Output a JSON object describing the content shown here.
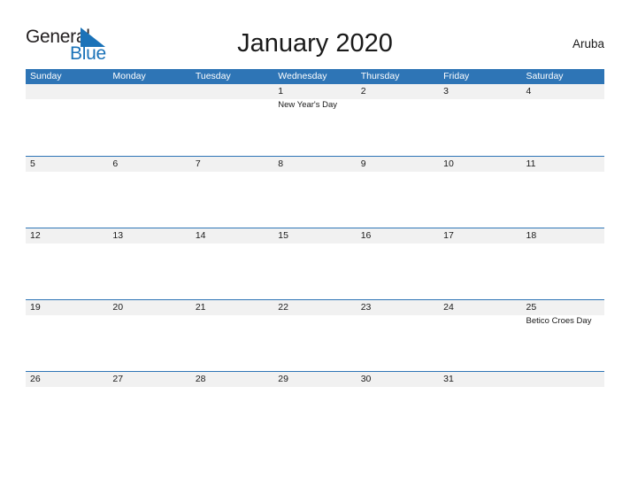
{
  "brand": {
    "name_part1": "General",
    "name_part2": "Blue",
    "triangle_color": "#1a72b8",
    "text_color": "#231f20"
  },
  "header": {
    "title": "January 2020",
    "country": "Aruba"
  },
  "theme": {
    "header_blue": "#2e75b6",
    "band_gray": "#f1f1f1",
    "rule_blue": "#2e75b6",
    "page_background": "#ffffff",
    "text_color": "#1a1a1a"
  },
  "calendar": {
    "month": "January",
    "year": "2020",
    "weekday_headers": [
      "Sunday",
      "Monday",
      "Tuesday",
      "Wednesday",
      "Thursday",
      "Friday",
      "Saturday"
    ],
    "weeks": [
      [
        {
          "date": "",
          "event": ""
        },
        {
          "date": "",
          "event": ""
        },
        {
          "date": "",
          "event": ""
        },
        {
          "date": "1",
          "event": "New Year's Day"
        },
        {
          "date": "2",
          "event": ""
        },
        {
          "date": "3",
          "event": ""
        },
        {
          "date": "4",
          "event": ""
        }
      ],
      [
        {
          "date": "5",
          "event": ""
        },
        {
          "date": "6",
          "event": ""
        },
        {
          "date": "7",
          "event": ""
        },
        {
          "date": "8",
          "event": ""
        },
        {
          "date": "9",
          "event": ""
        },
        {
          "date": "10",
          "event": ""
        },
        {
          "date": "11",
          "event": ""
        }
      ],
      [
        {
          "date": "12",
          "event": ""
        },
        {
          "date": "13",
          "event": ""
        },
        {
          "date": "14",
          "event": ""
        },
        {
          "date": "15",
          "event": ""
        },
        {
          "date": "16",
          "event": ""
        },
        {
          "date": "17",
          "event": ""
        },
        {
          "date": "18",
          "event": ""
        }
      ],
      [
        {
          "date": "19",
          "event": ""
        },
        {
          "date": "20",
          "event": ""
        },
        {
          "date": "21",
          "event": ""
        },
        {
          "date": "22",
          "event": ""
        },
        {
          "date": "23",
          "event": ""
        },
        {
          "date": "24",
          "event": ""
        },
        {
          "date": "25",
          "event": "Betico Croes Day"
        }
      ],
      [
        {
          "date": "26",
          "event": ""
        },
        {
          "date": "27",
          "event": ""
        },
        {
          "date": "28",
          "event": ""
        },
        {
          "date": "29",
          "event": ""
        },
        {
          "date": "30",
          "event": ""
        },
        {
          "date": "31",
          "event": ""
        },
        {
          "date": "",
          "event": ""
        }
      ]
    ],
    "holidays": [
      {
        "date": "1",
        "name": "New Year's Day"
      },
      {
        "date": "25",
        "name": "Betico Croes Day"
      }
    ]
  }
}
